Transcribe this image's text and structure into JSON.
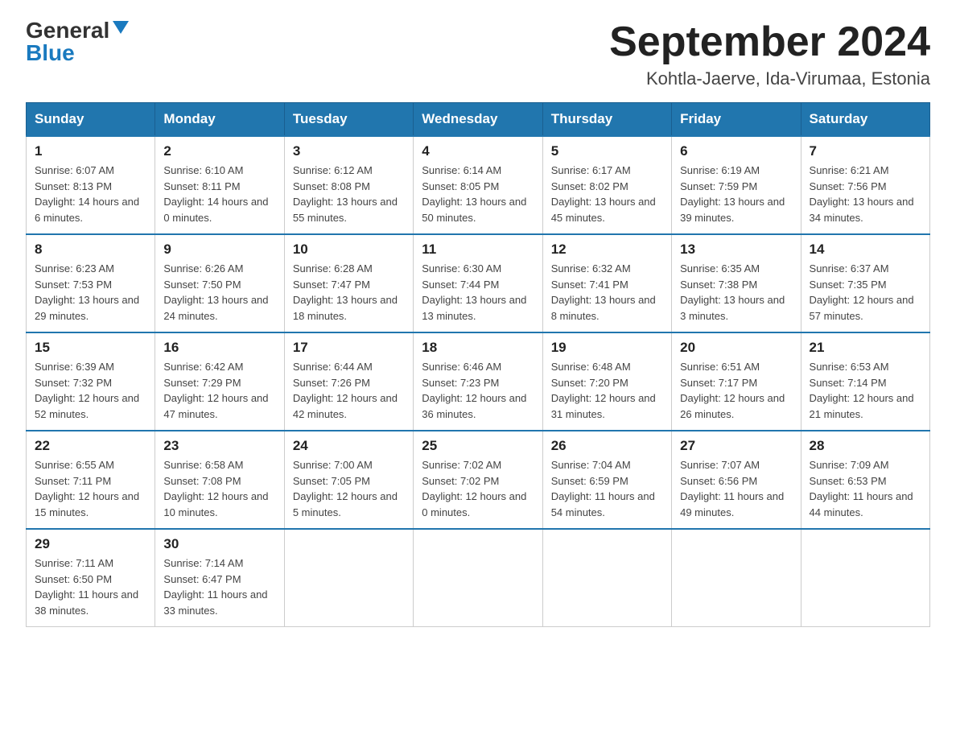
{
  "header": {
    "logo_general": "General",
    "logo_blue": "Blue",
    "title": "September 2024",
    "subtitle": "Kohtla-Jaerve, Ida-Virumaa, Estonia"
  },
  "days_of_week": [
    "Sunday",
    "Monday",
    "Tuesday",
    "Wednesday",
    "Thursday",
    "Friday",
    "Saturday"
  ],
  "weeks": [
    [
      {
        "day": "1",
        "sunrise": "Sunrise: 6:07 AM",
        "sunset": "Sunset: 8:13 PM",
        "daylight": "Daylight: 14 hours and 6 minutes."
      },
      {
        "day": "2",
        "sunrise": "Sunrise: 6:10 AM",
        "sunset": "Sunset: 8:11 PM",
        "daylight": "Daylight: 14 hours and 0 minutes."
      },
      {
        "day": "3",
        "sunrise": "Sunrise: 6:12 AM",
        "sunset": "Sunset: 8:08 PM",
        "daylight": "Daylight: 13 hours and 55 minutes."
      },
      {
        "day": "4",
        "sunrise": "Sunrise: 6:14 AM",
        "sunset": "Sunset: 8:05 PM",
        "daylight": "Daylight: 13 hours and 50 minutes."
      },
      {
        "day": "5",
        "sunrise": "Sunrise: 6:17 AM",
        "sunset": "Sunset: 8:02 PM",
        "daylight": "Daylight: 13 hours and 45 minutes."
      },
      {
        "day": "6",
        "sunrise": "Sunrise: 6:19 AM",
        "sunset": "Sunset: 7:59 PM",
        "daylight": "Daylight: 13 hours and 39 minutes."
      },
      {
        "day": "7",
        "sunrise": "Sunrise: 6:21 AM",
        "sunset": "Sunset: 7:56 PM",
        "daylight": "Daylight: 13 hours and 34 minutes."
      }
    ],
    [
      {
        "day": "8",
        "sunrise": "Sunrise: 6:23 AM",
        "sunset": "Sunset: 7:53 PM",
        "daylight": "Daylight: 13 hours and 29 minutes."
      },
      {
        "day": "9",
        "sunrise": "Sunrise: 6:26 AM",
        "sunset": "Sunset: 7:50 PM",
        "daylight": "Daylight: 13 hours and 24 minutes."
      },
      {
        "day": "10",
        "sunrise": "Sunrise: 6:28 AM",
        "sunset": "Sunset: 7:47 PM",
        "daylight": "Daylight: 13 hours and 18 minutes."
      },
      {
        "day": "11",
        "sunrise": "Sunrise: 6:30 AM",
        "sunset": "Sunset: 7:44 PM",
        "daylight": "Daylight: 13 hours and 13 minutes."
      },
      {
        "day": "12",
        "sunrise": "Sunrise: 6:32 AM",
        "sunset": "Sunset: 7:41 PM",
        "daylight": "Daylight: 13 hours and 8 minutes."
      },
      {
        "day": "13",
        "sunrise": "Sunrise: 6:35 AM",
        "sunset": "Sunset: 7:38 PM",
        "daylight": "Daylight: 13 hours and 3 minutes."
      },
      {
        "day": "14",
        "sunrise": "Sunrise: 6:37 AM",
        "sunset": "Sunset: 7:35 PM",
        "daylight": "Daylight: 12 hours and 57 minutes."
      }
    ],
    [
      {
        "day": "15",
        "sunrise": "Sunrise: 6:39 AM",
        "sunset": "Sunset: 7:32 PM",
        "daylight": "Daylight: 12 hours and 52 minutes."
      },
      {
        "day": "16",
        "sunrise": "Sunrise: 6:42 AM",
        "sunset": "Sunset: 7:29 PM",
        "daylight": "Daylight: 12 hours and 47 minutes."
      },
      {
        "day": "17",
        "sunrise": "Sunrise: 6:44 AM",
        "sunset": "Sunset: 7:26 PM",
        "daylight": "Daylight: 12 hours and 42 minutes."
      },
      {
        "day": "18",
        "sunrise": "Sunrise: 6:46 AM",
        "sunset": "Sunset: 7:23 PM",
        "daylight": "Daylight: 12 hours and 36 minutes."
      },
      {
        "day": "19",
        "sunrise": "Sunrise: 6:48 AM",
        "sunset": "Sunset: 7:20 PM",
        "daylight": "Daylight: 12 hours and 31 minutes."
      },
      {
        "day": "20",
        "sunrise": "Sunrise: 6:51 AM",
        "sunset": "Sunset: 7:17 PM",
        "daylight": "Daylight: 12 hours and 26 minutes."
      },
      {
        "day": "21",
        "sunrise": "Sunrise: 6:53 AM",
        "sunset": "Sunset: 7:14 PM",
        "daylight": "Daylight: 12 hours and 21 minutes."
      }
    ],
    [
      {
        "day": "22",
        "sunrise": "Sunrise: 6:55 AM",
        "sunset": "Sunset: 7:11 PM",
        "daylight": "Daylight: 12 hours and 15 minutes."
      },
      {
        "day": "23",
        "sunrise": "Sunrise: 6:58 AM",
        "sunset": "Sunset: 7:08 PM",
        "daylight": "Daylight: 12 hours and 10 minutes."
      },
      {
        "day": "24",
        "sunrise": "Sunrise: 7:00 AM",
        "sunset": "Sunset: 7:05 PM",
        "daylight": "Daylight: 12 hours and 5 minutes."
      },
      {
        "day": "25",
        "sunrise": "Sunrise: 7:02 AM",
        "sunset": "Sunset: 7:02 PM",
        "daylight": "Daylight: 12 hours and 0 minutes."
      },
      {
        "day": "26",
        "sunrise": "Sunrise: 7:04 AM",
        "sunset": "Sunset: 6:59 PM",
        "daylight": "Daylight: 11 hours and 54 minutes."
      },
      {
        "day": "27",
        "sunrise": "Sunrise: 7:07 AM",
        "sunset": "Sunset: 6:56 PM",
        "daylight": "Daylight: 11 hours and 49 minutes."
      },
      {
        "day": "28",
        "sunrise": "Sunrise: 7:09 AM",
        "sunset": "Sunset: 6:53 PM",
        "daylight": "Daylight: 11 hours and 44 minutes."
      }
    ],
    [
      {
        "day": "29",
        "sunrise": "Sunrise: 7:11 AM",
        "sunset": "Sunset: 6:50 PM",
        "daylight": "Daylight: 11 hours and 38 minutes."
      },
      {
        "day": "30",
        "sunrise": "Sunrise: 7:14 AM",
        "sunset": "Sunset: 6:47 PM",
        "daylight": "Daylight: 11 hours and 33 minutes."
      },
      null,
      null,
      null,
      null,
      null
    ]
  ]
}
